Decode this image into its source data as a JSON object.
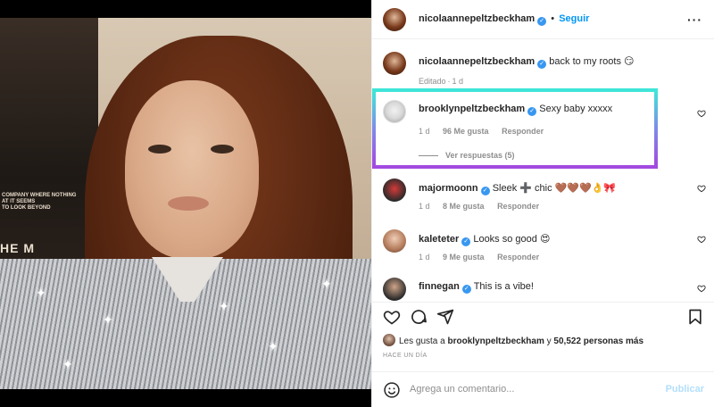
{
  "post": {
    "owner": "nicolaannepeltzbeckham",
    "follow_label": "Seguir",
    "more_icon": "more-horizontal-icon"
  },
  "caption": {
    "user": "nicolaannepeltzbeckham",
    "text": "back to my roots 😏",
    "edited": "Editado",
    "time": "1 d"
  },
  "comments": [
    {
      "user": "brooklynpeltzbeckham",
      "text": "Sexy baby xxxxx",
      "time": "1 d",
      "likes": "96 Me gusta",
      "reply": "Responder",
      "replies": "Ver respuestas (5)"
    },
    {
      "user": "majormoonn",
      "text": "Sleek ➕ chic 🤎🤎🤎👌🎀",
      "time": "1 d",
      "likes": "8 Me gusta",
      "reply": "Responder"
    },
    {
      "user": "kaleteter",
      "text": "Looks so good 😍",
      "time": "1 d",
      "likes": "9 Me gusta",
      "reply": "Responder"
    },
    {
      "user": "finnegan",
      "text": "This is a vibe!"
    }
  ],
  "liked_by": {
    "prefix": "Les gusta a",
    "user": "brooklynpeltzbeckham",
    "middle": "y",
    "rest": "50,522 personas más"
  },
  "posted_ago": "HACE UN DÍA",
  "composer": {
    "placeholder": "Agrega un comentario...",
    "publish": "Publicar"
  },
  "photo_poster": {
    "small_text": "COMPANY WHERE NOTHING\nAT IT SEEMS\nTO LOOK BEYOND",
    "big_text": "HE M"
  },
  "colors": {
    "accent": "#0095f6",
    "verified": "#3897f0",
    "highlight_top": "#3ee6d8",
    "highlight_bottom": "#a24ae0"
  }
}
